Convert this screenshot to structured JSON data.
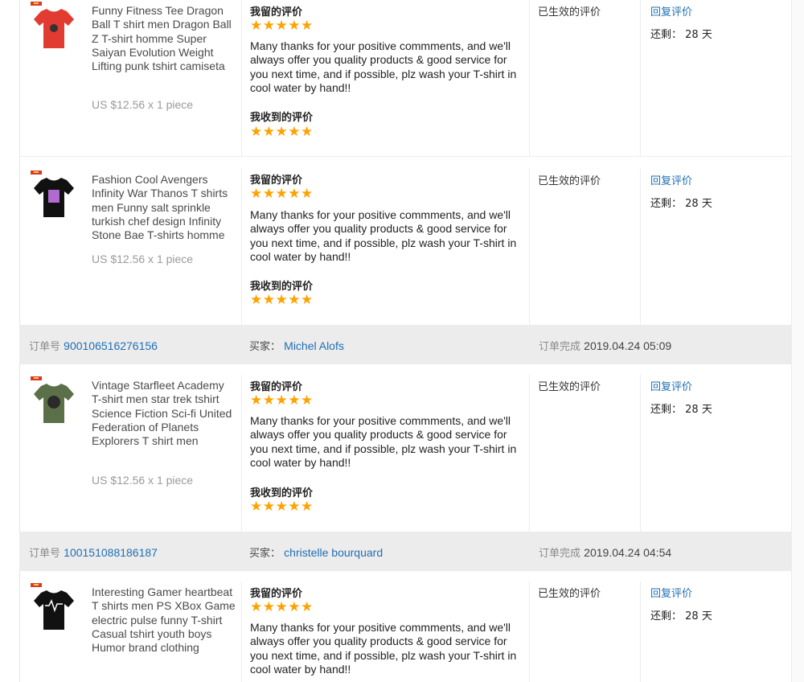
{
  "orders": [
    {
      "header": null,
      "item": {
        "product_name": "Funny Fitness Tee Dragon Ball T shirt men Dragon Ball Z T-shirt homme Super Saiyan Evolution Weight Lifting punk tshirt camiseta",
        "price_line": "US $12.56 x 1 piece",
        "tee_color": "#e23b32",
        "my_review_label": "我留的评价",
        "stars": "★★★★★",
        "review_text": "Many thanks for your positive commments, and we'll always offer you quality products & good service for you next time, and if possible, plz wash your T-shirt in cool water by hand!!",
        "received_review_label": "我收到的评价",
        "received_stars": "★★★★★",
        "status": "已生效的评价",
        "reply_link": "回复评价",
        "remaining_label": "还剩：",
        "remaining_value": "28 天"
      }
    },
    {
      "header": null,
      "item": {
        "product_name": "Fashion Cool Avengers Infinity War Thanos T shirts men Funny salt sprinkle turkish chef design Infinity Stone Bae T-shirts homme",
        "price_line": "US $12.56 x 1 piece",
        "tee_color": "#111111",
        "my_review_label": "我留的评价",
        "stars": "★★★★★",
        "review_text": "Many thanks for your positive commments, and we'll always offer you quality products & good service for you next time, and if possible, plz wash your T-shirt in cool water by hand!!",
        "received_review_label": "我收到的评价",
        "received_stars": "★★★★★",
        "status": "已生效的评价",
        "reply_link": "回复评价",
        "remaining_label": "还剩：",
        "remaining_value": "28 天"
      }
    },
    {
      "header": {
        "order_label": "订单号",
        "order_number": "900106516276156",
        "buyer_label": "买家：",
        "buyer_name": "Michel Alofs",
        "completed_label": "订单完成",
        "completed_time": "2019.04.24 05:09"
      },
      "item": {
        "product_name": "Vintage Starfleet Academy T-shirt men star trek tshirt Science Fiction Sci-fi United Federation of Planets Explorers T shirt men",
        "price_line": "US $12.56 x 1 piece",
        "tee_color": "#5b7049",
        "my_review_label": "我留的评价",
        "stars": "★★★★★",
        "review_text": "Many thanks for your positive commments, and we'll always offer you quality products & good service for you next time, and if possible, plz wash your T-shirt in cool water by hand!!",
        "received_review_label": "我收到的评价",
        "received_stars": "★★★★★",
        "status": "已生效的评价",
        "reply_link": "回复评价",
        "remaining_label": "还剩：",
        "remaining_value": "28 天"
      }
    },
    {
      "header": {
        "order_label": "订单号",
        "order_number": "100151088186187",
        "buyer_label": "买家：",
        "buyer_name": "christelle bourquard",
        "completed_label": "订单完成",
        "completed_time": "2019.04.24 04:54"
      },
      "item": {
        "product_name": "Interesting Gamer heartbeat T shirts men PS XBox Game electric pulse funny T-shirt Casual tshirt youth boys Humor brand clothing",
        "price_line": "",
        "tee_color": "#111111",
        "my_review_label": "我留的评价",
        "stars": "★★★★★",
        "review_text": "Many thanks for your positive commments, and we'll always offer you quality products & good service for you next time, and if possible, plz wash your T-shirt in cool water by hand!!",
        "received_review_label": "",
        "received_stars": "",
        "status": "已生效的评价",
        "reply_link": "回复评价",
        "remaining_label": "还剩：",
        "remaining_value": "28 天"
      }
    }
  ]
}
